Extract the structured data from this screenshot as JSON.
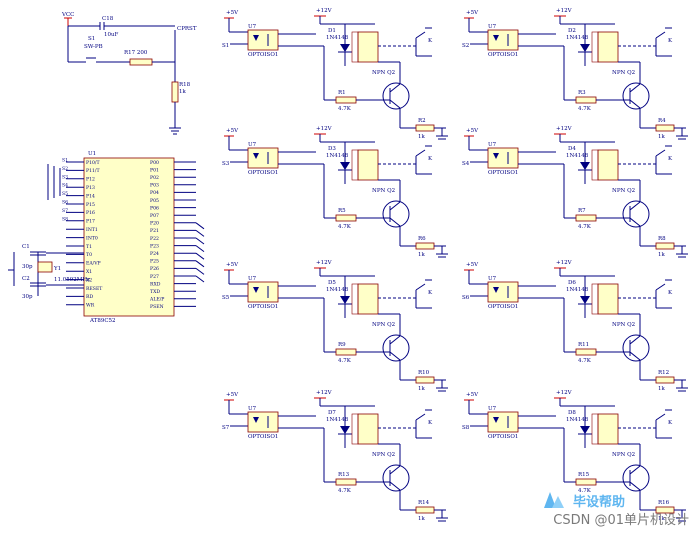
{
  "power": {
    "vcc": "VCC",
    "v5": "+5V",
    "v12": "+12V"
  },
  "reset": {
    "cap": "C18",
    "cap_value": "10uF",
    "switch_ref": "S1",
    "switch": "SW-PB",
    "r17": "R17 200",
    "r18": "R18",
    "r18v": "1k",
    "net": "CPRST"
  },
  "crystal": {
    "c1": "C1",
    "c1v": "30p",
    "c2": "C2",
    "c2v": "30p",
    "y": "Y1",
    "yv": "11.0592MHz"
  },
  "mcu": {
    "ref": "U1",
    "part": "AT89C52",
    "left_pins": [
      "P10/T",
      "P11/T",
      "P12",
      "P13",
      "P14",
      "P15",
      "P16",
      "P17",
      "INT1",
      "INT0",
      "T1",
      "T0",
      "EA/VP",
      "X1",
      "X2",
      "RESET",
      "RD",
      "WR"
    ],
    "right_pins": [
      "P00",
      "P01",
      "P02",
      "P03",
      "P04",
      "P05",
      "P06",
      "P07",
      "P20",
      "P21",
      "P22",
      "P23",
      "P24",
      "P25",
      "P26",
      "P27",
      "RXD",
      "TXD",
      "ALE/P",
      "PSEN"
    ],
    "left_nets": [
      "S1",
      "S2",
      "S3",
      "S4",
      "S5",
      "S6",
      "S7",
      "S8"
    ]
  },
  "channels": [
    {
      "s": "S1",
      "r": "R1",
      "rb": "R2",
      "d": "D1"
    },
    {
      "s": "S2",
      "r": "R3",
      "rb": "R4",
      "d": "D2"
    },
    {
      "s": "S3",
      "r": "R5",
      "rb": "R6",
      "d": "D3"
    },
    {
      "s": "S4",
      "r": "R7",
      "rb": "R8",
      "d": "D4"
    },
    {
      "s": "S5",
      "r": "R9",
      "rb": "R10",
      "d": "D5"
    },
    {
      "s": "S6",
      "r": "R11",
      "rb": "R12",
      "d": "D6"
    },
    {
      "s": "S7",
      "r": "R13",
      "rb": "R14",
      "d": "D7"
    },
    {
      "s": "S8",
      "r": "R15",
      "rb": "R16",
      "d": "D8"
    }
  ],
  "channel_labels": {
    "opto_ref": "U7",
    "opto": "OPTOISO1",
    "r_value": "4.7K",
    "rb_value": "1k",
    "q": "NPN Q2",
    "diode": "1N4148",
    "k": "K"
  },
  "brand": "毕设帮助",
  "watermark": "CSDN @01单片机设计"
}
